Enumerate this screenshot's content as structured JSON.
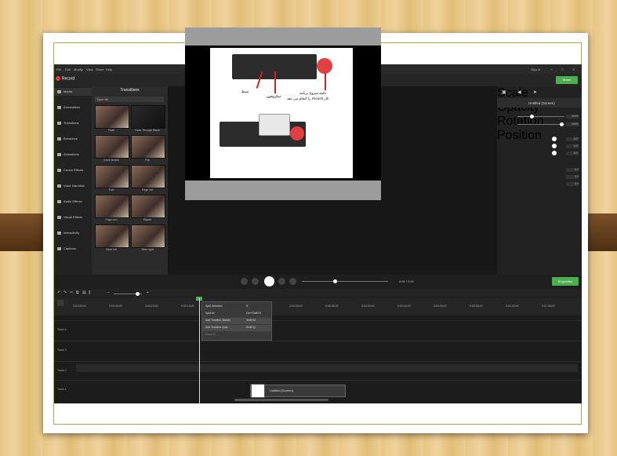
{
  "app": {
    "title": "Camtasia - Untitled Project.tscproj*",
    "menu": [
      "File",
      "Edit",
      "Modify",
      "View",
      "Share",
      "Help"
    ],
    "sign_in": "Sign in",
    "record_label": "Record",
    "zoom": "43%",
    "share_label": "Share"
  },
  "sidebar": {
    "items": [
      {
        "label": "Media"
      },
      {
        "label": "Annotations"
      },
      {
        "label": "Transitions"
      },
      {
        "label": "Behaviors"
      },
      {
        "label": "Animations"
      },
      {
        "label": "Cursor Effects"
      },
      {
        "label": "Voice Narration"
      },
      {
        "label": "Audio Effects"
      },
      {
        "label": "Visual Effects"
      },
      {
        "label": "Interactivity"
      },
      {
        "label": "Captions"
      }
    ]
  },
  "transitions": {
    "header": "Transitions",
    "type_label": "Type:",
    "type_value": "All",
    "items": [
      {
        "label": "Fade"
      },
      {
        "label": "Fade Through Black"
      },
      {
        "label": "Circle stretch"
      },
      {
        "label": "Flip"
      },
      {
        "label": "Fold"
      },
      {
        "label": "Page roll"
      },
      {
        "label": "Page turn"
      },
      {
        "label": "Ripple"
      },
      {
        "label": "Slide left"
      },
      {
        "label": "Slide right"
      }
    ]
  },
  "slide": {
    "annotations": [
      {
        "text": "ضبط"
      },
      {
        "text": "میکروفون"
      },
      {
        "text": "دکمه شروع برنامه"
      },
      {
        "text": "کار record را انجام می دهد"
      }
    ]
  },
  "properties": {
    "title": "Untitled (Screen)",
    "scale_label": "Scale",
    "scale_value": "100%",
    "opacity_label": "Opacity",
    "opacity_value": "100%",
    "rotation_label": "Rotation",
    "position_label": "Position",
    "rotation_values": [
      "0.0°",
      "0.0°",
      "0.0°"
    ],
    "position_values": [
      "0.0",
      "0.0",
      "0.0"
    ]
  },
  "player": {
    "time": "0:00 / 0:02",
    "properties_btn": "Properties"
  },
  "timeline": {
    "zoom_icon": "magnifier-icon",
    "ruler": [
      "0:00:00;00",
      "0:00:05;00",
      "0:00:10;00",
      "0:00:15;00",
      "0:00:20;00",
      "0:00:25;00",
      "0:00:30;00",
      "0:00:35;00",
      "0:00:40;00",
      "0:00:45;00",
      "0:00:50;00",
      "0:00:55;00",
      "0:01:00;00",
      "0:01:05;00"
    ],
    "tracks": [
      "Track 4",
      "Track 3",
      "Track 2",
      "Track 1"
    ],
    "context_menu": [
      {
        "label": "Split Selected",
        "shortcut": "S"
      },
      {
        "label": "Split All",
        "shortcut": "Ctrl+Shift+S"
      },
      {
        "label": "Add Timeline Marker",
        "shortcut": "Shift+M"
      },
      {
        "label": "Add Timeline Quiz",
        "shortcut": "Shift+Q"
      },
      {
        "label": "Zoom fit",
        "shortcut": ""
      }
    ],
    "clip_label": "Untitled (Screen)"
  }
}
